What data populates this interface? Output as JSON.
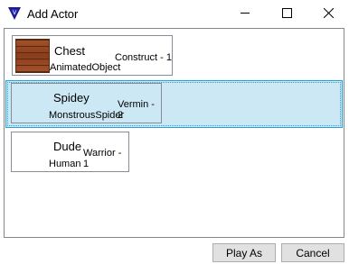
{
  "window": {
    "title": "Add Actor",
    "icons": {
      "app": "triangle-logo-icon",
      "minimize": "minimize-icon",
      "maximize": "maximize-icon",
      "close": "close-icon"
    }
  },
  "actors": [
    {
      "name": "Chest",
      "type": "AnimatedObject",
      "class_level": "Construct - 1",
      "portrait": "wooden-chest-image",
      "selected": false
    },
    {
      "name": "Spidey",
      "type": "MonstrousSpider",
      "class_level": "Vermin - 2",
      "portrait": "",
      "selected": true
    },
    {
      "name": "Dude",
      "type": "Human",
      "class_level": "Warrior - 1",
      "portrait": "",
      "selected": false
    }
  ],
  "buttons": {
    "play_as": "Play As",
    "cancel": "Cancel"
  },
  "colors": {
    "selection_bg": "#cde8f5",
    "selection_border": "#26a0da",
    "button_bg": "#e1e1e1"
  }
}
